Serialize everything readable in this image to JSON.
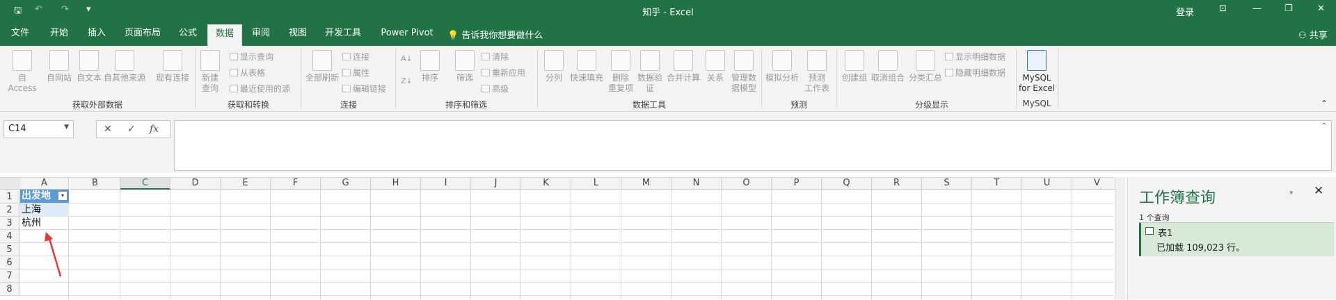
{
  "titlebar": {
    "title": "知乎  -  Excel",
    "login": "登录",
    "save_glyph": "🖫",
    "undo_glyph": "↶",
    "redo_glyph": "↷",
    "customize_glyph": "▾",
    "ribbon_opts_glyph": "⊡",
    "minimize_glyph": "—",
    "restore_glyph": "❐",
    "close_glyph": "✕"
  },
  "tabs": [
    "文件",
    "开始",
    "插入",
    "页面布局",
    "公式",
    "数据",
    "审阅",
    "视图",
    "开发工具",
    "Power Pivot"
  ],
  "active_tab": "数据",
  "tell_me": "💡 告诉我你想要做什么",
  "share": "⚇ 共享",
  "ribbon": {
    "get_external": {
      "label": "获取外部数据",
      "items": [
        "自 Access",
        "自网站",
        "自文本",
        "自其他来源",
        "现有连接"
      ]
    },
    "get_transform": {
      "label": "获取和转换",
      "new_query": "新建\n查询",
      "small": [
        "显示查询",
        "从表格",
        "最近使用的源"
      ]
    },
    "connections": {
      "label": "连接",
      "refresh_all": "全部刷新",
      "small": [
        "连接",
        "属性",
        "编辑链接"
      ]
    },
    "sort_filter": {
      "label": "排序和筛选",
      "sort": "排序",
      "filter": "筛选",
      "small": [
        "清除",
        "重新应用",
        "高级"
      ]
    },
    "data_tools": {
      "label": "数据工具",
      "items": [
        "分列",
        "快速填充",
        "删除\n重复项",
        "数据验\n证",
        "合并计算",
        "关系",
        "管理数\n据模型"
      ]
    },
    "forecast": {
      "label": "预测",
      "items": [
        "模拟分析",
        "预测\n工作表"
      ]
    },
    "outline": {
      "label": "分级显示",
      "items": [
        "创建组",
        "取消组合",
        "分类汇总"
      ],
      "small": [
        "显示明细数据",
        "隐藏明细数据"
      ]
    },
    "mysql": {
      "label": "MySQL",
      "button": "MySQL\nfor Excel"
    }
  },
  "formula_bar": {
    "name_box": "C14",
    "cancel": "✕",
    "enter": "✓",
    "fx": "fx",
    "value": ""
  },
  "sheet": {
    "columns": [
      "A",
      "B",
      "C",
      "D",
      "E",
      "F",
      "G",
      "H",
      "I",
      "J",
      "K",
      "L",
      "M",
      "N",
      "O",
      "P",
      "Q",
      "R",
      "S",
      "T",
      "U",
      "V"
    ],
    "selected_column": "C",
    "rows": [
      "1",
      "2",
      "3",
      "4",
      "5",
      "6",
      "7",
      "8"
    ],
    "cells": {
      "A1": "出发地",
      "A2": "上海",
      "A3": "杭州"
    },
    "filter_glyph": "▾"
  },
  "pane": {
    "title": "工作簿查询",
    "min_glyph": "▾",
    "close_glyph": "✕",
    "count": "1 个查询",
    "query_name": "表1",
    "query_status": "已加载 109,023 行。"
  },
  "colors": {
    "brand": "#217346",
    "table_header": "#5b9bd5",
    "arrow": "#e53935"
  }
}
